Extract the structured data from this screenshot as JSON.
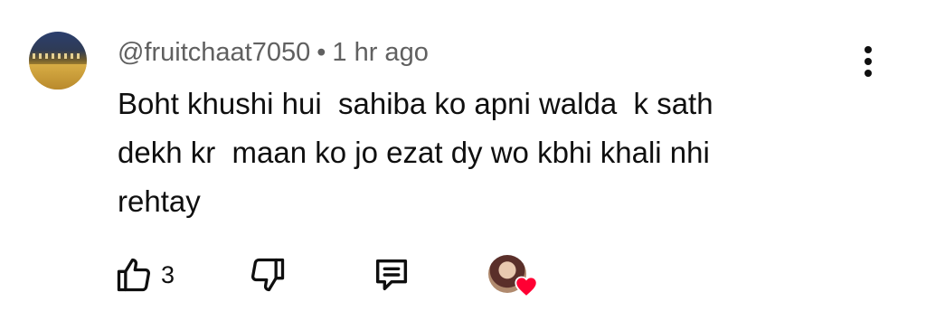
{
  "comment": {
    "author": "@fruitchaat7050",
    "separator": "•",
    "time": "1 hr ago",
    "text": "Boht khushi hui  sahiba ko apni walda  k sath\ndekh kr  maan ko jo ezat dy wo kbhi khali nhi\nrehtay",
    "like_count": "3"
  },
  "icons": {
    "more": "more-vert-icon",
    "like": "thumbs-up-icon",
    "dislike": "thumbs-down-icon",
    "reply": "reply-comment-icon",
    "heart": "heart-icon"
  },
  "colors": {
    "text": "#0f0f0f",
    "meta": "#606060",
    "heart": "#ff0033"
  }
}
